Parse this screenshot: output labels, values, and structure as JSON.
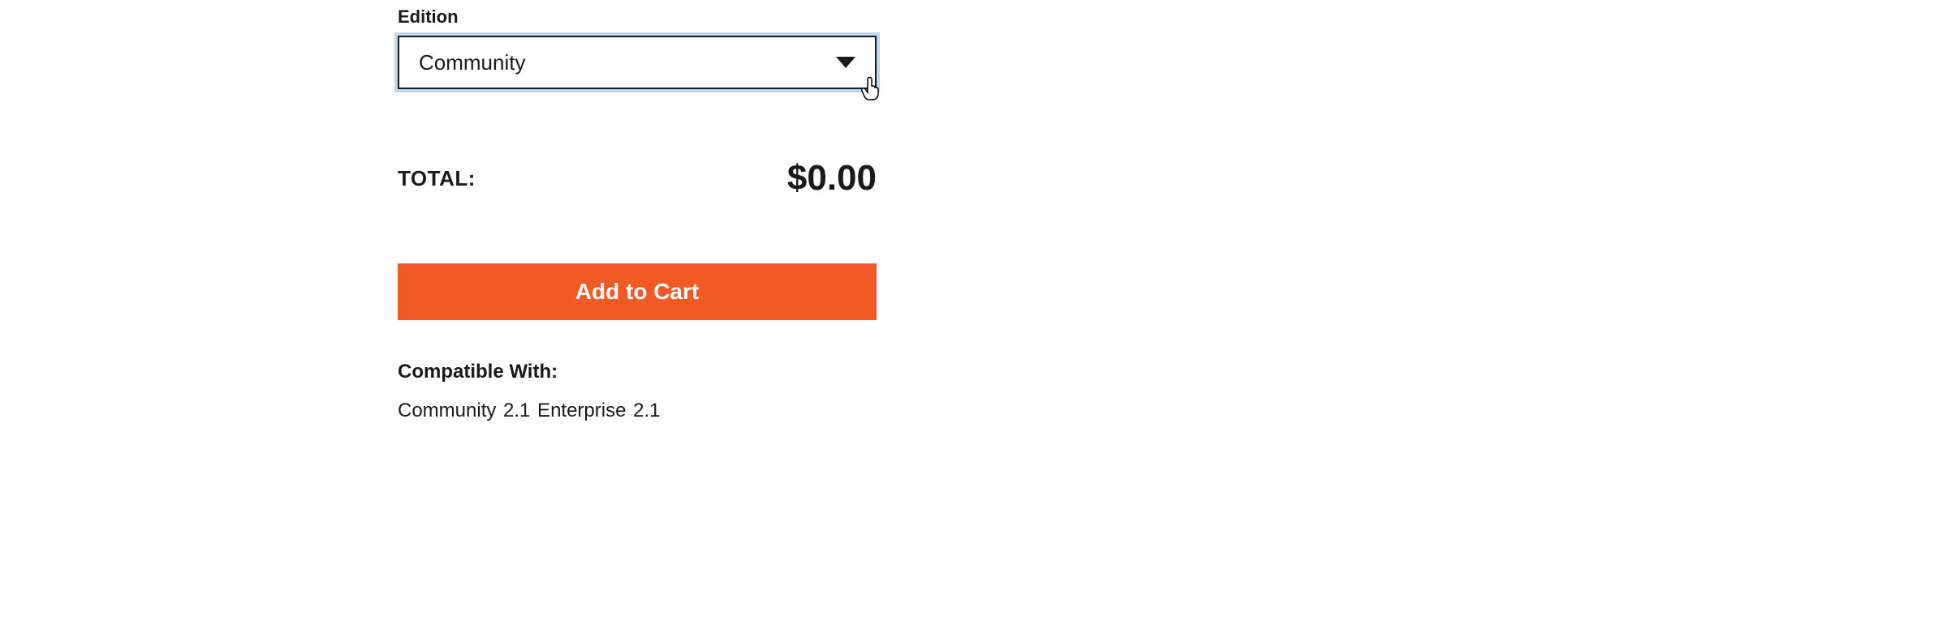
{
  "edition": {
    "label": "Edition",
    "selected": "Community"
  },
  "total": {
    "label": "TOTAL:",
    "value": "$0.00"
  },
  "add_to_cart_label": "Add to Cart",
  "compatible": {
    "label": "Compatible With:",
    "value": "Community 2.1 Enterprise   2.1"
  }
}
